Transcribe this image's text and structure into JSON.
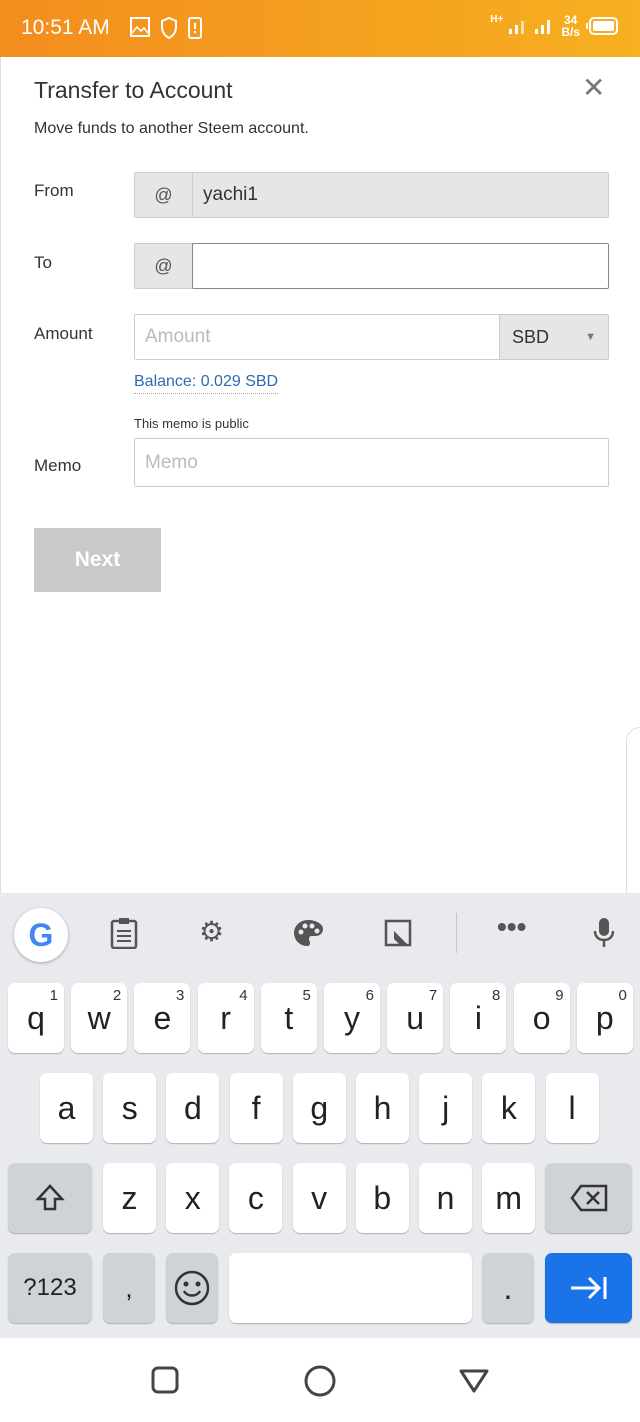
{
  "status_bar": {
    "time": "10:51 AM",
    "network": "H+",
    "speed_value": "34",
    "speed_unit": "B/s",
    "icons": [
      "image-icon",
      "shield-icon",
      "phone-alert-icon",
      "signal-icon",
      "signal-icon",
      "battery-icon"
    ]
  },
  "dialog": {
    "title": "Transfer to Account",
    "subtitle": "Move funds to another Steem account.",
    "close_icon": "close-icon",
    "from": {
      "label": "From",
      "prefix": "@",
      "value": "yachi1"
    },
    "to": {
      "label": "To",
      "prefix": "@",
      "value": ""
    },
    "amount": {
      "label": "Amount",
      "placeholder": "Amount",
      "currency": "SBD",
      "balance": "Balance: 0.029 SBD"
    },
    "memo": {
      "label": "Memo",
      "hint": "This memo is public",
      "placeholder": "Memo"
    },
    "next_label": "Next"
  },
  "keyboard": {
    "toolbar": [
      "google-icon",
      "clipboard-icon",
      "gear-icon",
      "palette-icon",
      "screenshot-icon",
      "more-icon",
      "microphone-icon"
    ],
    "row1": [
      [
        "q",
        "1"
      ],
      [
        "w",
        "2"
      ],
      [
        "e",
        "3"
      ],
      [
        "r",
        "4"
      ],
      [
        "t",
        "5"
      ],
      [
        "y",
        "6"
      ],
      [
        "u",
        "7"
      ],
      [
        "i",
        "8"
      ],
      [
        "o",
        "9"
      ],
      [
        "p",
        "0"
      ]
    ],
    "row2": [
      "a",
      "s",
      "d",
      "f",
      "g",
      "h",
      "j",
      "k",
      "l"
    ],
    "row3": [
      "z",
      "x",
      "c",
      "v",
      "b",
      "n",
      "m"
    ],
    "symbols_label": "?123",
    "comma": ",",
    "period": "."
  },
  "nav": [
    "recents-icon",
    "home-icon",
    "back-icon"
  ],
  "colors": {
    "status_bar": "#f38d1e",
    "link": "#2d6bb0",
    "enter_key": "#1a73e8",
    "next_disabled": "#c8c9cb"
  }
}
